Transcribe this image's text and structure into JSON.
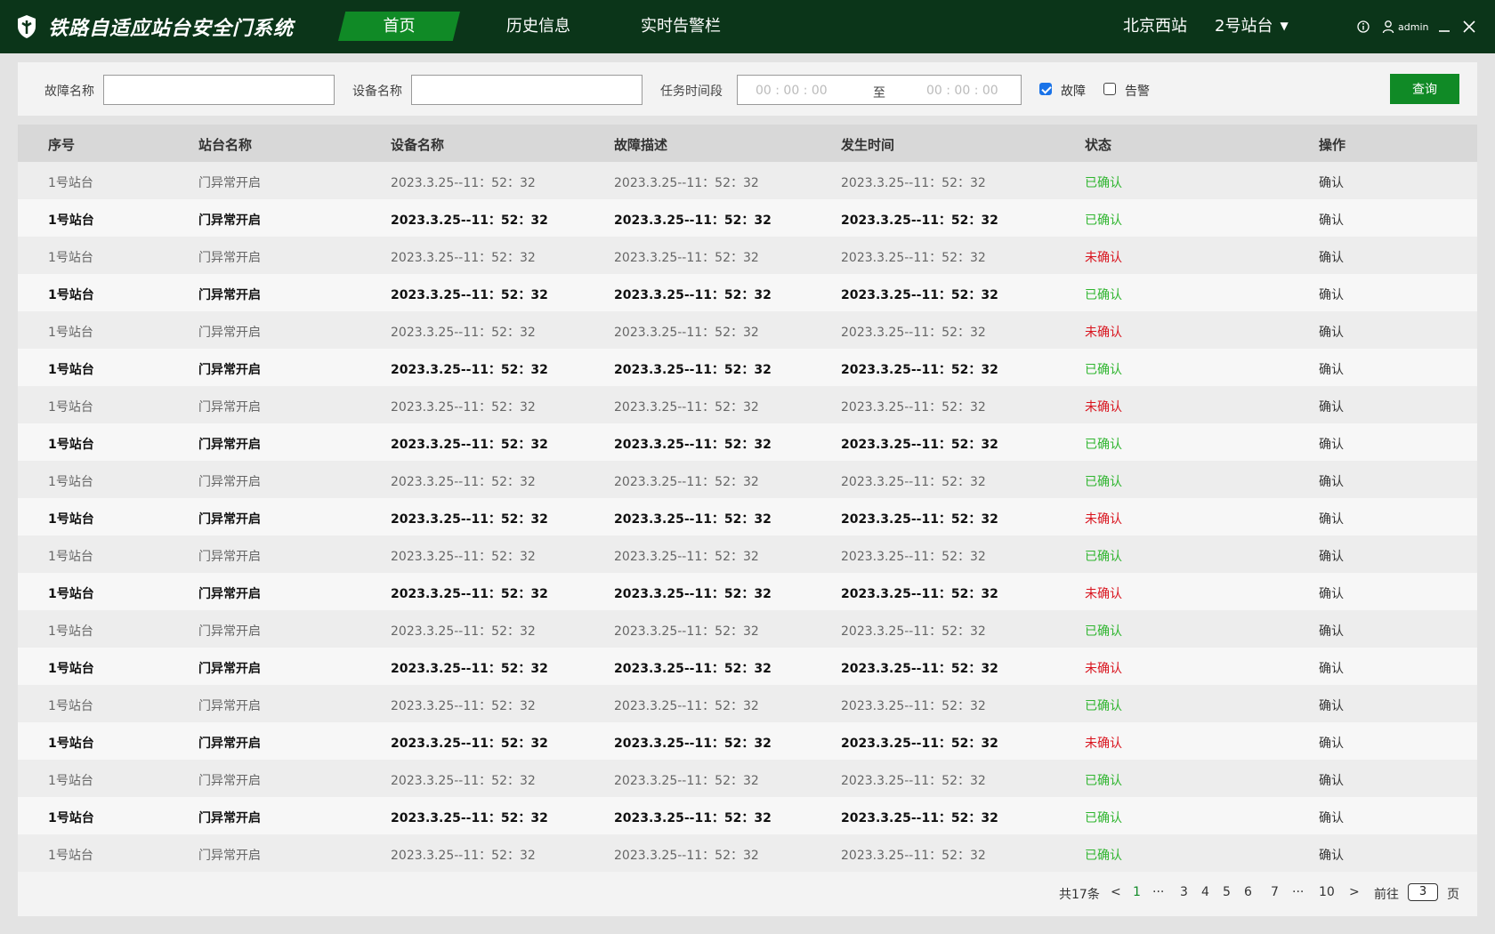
{
  "header": {
    "logo_icon": "shield-icon",
    "title": "铁路自适应站台安全门系统",
    "nav": [
      {
        "label": "首页",
        "active": true
      },
      {
        "label": "历史信息",
        "active": false
      },
      {
        "label": "实时告警栏",
        "active": false
      }
    ],
    "station": "北京西站",
    "platform": "2号站台",
    "user": "admin",
    "icons": [
      "info-icon",
      "user-icon",
      "minimize-icon",
      "close-icon"
    ]
  },
  "filter": {
    "fault_name_label": "故障名称",
    "fault_name_value": "",
    "device_name_label": "设备名称",
    "device_name_value": "",
    "time_range_label": "任务时间段",
    "time_start": "00 : 00 : 00",
    "time_separator": "至",
    "time_end": "00 : 00 : 00",
    "checkbox_fault": {
      "label": "故障",
      "checked": true
    },
    "checkbox_alarm": {
      "label": "告警",
      "checked": false
    },
    "query_button": "查询"
  },
  "table": {
    "headers": [
      "序号",
      "站台名称",
      "设备名称",
      "故障描述",
      "发生时间",
      "状态",
      "操作"
    ],
    "rows": [
      [
        "1号站台",
        "门异常开启",
        "2023.3.25--11：52：32",
        "2023.3.25--11：52：32",
        "2023.3.25--11：52：32",
        "已确认",
        "确认"
      ],
      [
        "1号站台",
        "门异常开启",
        "2023.3.25--11：52：32",
        "2023.3.25--11：52：32",
        "2023.3.25--11：52：32",
        "已确认",
        "确认"
      ],
      [
        "1号站台",
        "门异常开启",
        "2023.3.25--11：52：32",
        "2023.3.25--11：52：32",
        "2023.3.25--11：52：32",
        "未确认",
        "确认"
      ],
      [
        "1号站台",
        "门异常开启",
        "2023.3.25--11：52：32",
        "2023.3.25--11：52：32",
        "2023.3.25--11：52：32",
        "已确认",
        "确认"
      ],
      [
        "1号站台",
        "门异常开启",
        "2023.3.25--11：52：32",
        "2023.3.25--11：52：32",
        "2023.3.25--11：52：32",
        "未确认",
        "确认"
      ],
      [
        "1号站台",
        "门异常开启",
        "2023.3.25--11：52：32",
        "2023.3.25--11：52：32",
        "2023.3.25--11：52：32",
        "已确认",
        "确认"
      ],
      [
        "1号站台",
        "门异常开启",
        "2023.3.25--11：52：32",
        "2023.3.25--11：52：32",
        "2023.3.25--11：52：32",
        "未确认",
        "确认"
      ],
      [
        "1号站台",
        "门异常开启",
        "2023.3.25--11：52：32",
        "2023.3.25--11：52：32",
        "2023.3.25--11：52：32",
        "已确认",
        "确认"
      ],
      [
        "1号站台",
        "门异常开启",
        "2023.3.25--11：52：32",
        "2023.3.25--11：52：32",
        "2023.3.25--11：52：32",
        "已确认",
        "确认"
      ],
      [
        "1号站台",
        "门异常开启",
        "2023.3.25--11：52：32",
        "2023.3.25--11：52：32",
        "2023.3.25--11：52：32",
        "未确认",
        "确认"
      ],
      [
        "1号站台",
        "门异常开启",
        "2023.3.25--11：52：32",
        "2023.3.25--11：52：32",
        "2023.3.25--11：52：32",
        "已确认",
        "确认"
      ],
      [
        "1号站台",
        "门异常开启",
        "2023.3.25--11：52：32",
        "2023.3.25--11：52：32",
        "2023.3.25--11：52：32",
        "未确认",
        "确认"
      ],
      [
        "1号站台",
        "门异常开启",
        "2023.3.25--11：52：32",
        "2023.3.25--11：52：32",
        "2023.3.25--11：52：32",
        "已确认",
        "确认"
      ],
      [
        "1号站台",
        "门异常开启",
        "2023.3.25--11：52：32",
        "2023.3.25--11：52：32",
        "2023.3.25--11：52：32",
        "未确认",
        "确认"
      ],
      [
        "1号站台",
        "门异常开启",
        "2023.3.25--11：52：32",
        "2023.3.25--11：52：32",
        "2023.3.25--11：52：32",
        "已确认",
        "确认"
      ],
      [
        "1号站台",
        "门异常开启",
        "2023.3.25--11：52：32",
        "2023.3.25--11：52：32",
        "2023.3.25--11：52：32",
        "未确认",
        "确认"
      ],
      [
        "1号站台",
        "门异常开启",
        "2023.3.25--11：52：32",
        "2023.3.25--11：52：32",
        "2023.3.25--11：52：32",
        "已确认",
        "确认"
      ],
      [
        "1号站台",
        "门异常开启",
        "2023.3.25--11：52：32",
        "2023.3.25--11：52：32",
        "2023.3.25--11：52：32",
        "已确认",
        "确认"
      ],
      [
        "1号站台",
        "门异常开启",
        "2023.3.25--11：52：32",
        "2023.3.25--11：52：32",
        "2023.3.25--11：52：32",
        "已确认",
        "确认"
      ]
    ]
  },
  "pagination": {
    "total": "共17条",
    "prev": "<",
    "pages": [
      "1",
      "···",
      "3",
      "4",
      "5",
      "6",
      "7",
      "···",
      "10"
    ],
    "current": "1",
    "next": ">",
    "goto_label": "前往",
    "goto_value": "3",
    "goto_unit": "页"
  },
  "colors": {
    "header_bg": "#0b3519",
    "accent_green": "#108a26",
    "status_confirmed": "#2fb52f",
    "status_unconfirmed": "#d9141e"
  }
}
